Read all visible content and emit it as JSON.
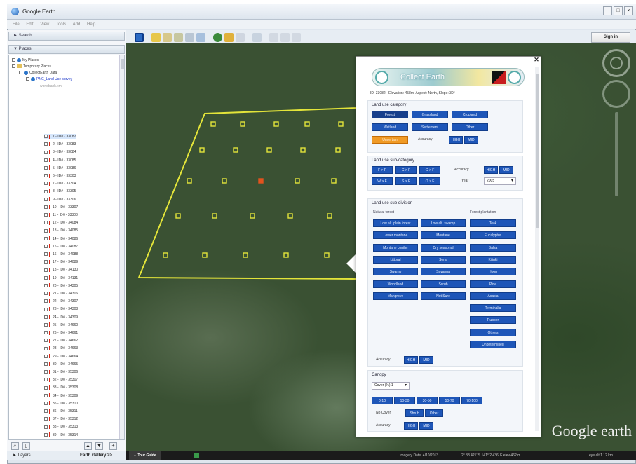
{
  "app": {
    "title": "Google Earth"
  },
  "window_controls": [
    "–",
    "□",
    "×"
  ],
  "menu": [
    "File",
    "Edit",
    "View",
    "Tools",
    "Add",
    "Help"
  ],
  "toolbar": {
    "signin_label": "Sign in"
  },
  "sidebar": {
    "search_label": "► Search",
    "places_label": "▼ Places",
    "tree": [
      {
        "label": "My Places",
        "type": "globe",
        "indent": 1
      },
      {
        "label": "Temporary Places",
        "type": "folder",
        "indent": 1
      },
      {
        "label": "CollectEarth Data",
        "type": "globe",
        "indent": 2
      },
      {
        "label": "PNG_Land Use survey",
        "type": "link",
        "indent": 3
      },
      {
        "label": "worldbank.xml",
        "type": "dim",
        "indent": 4
      }
    ],
    "items": [
      "1 - ID# - 33082",
      "2 - ID# - 33083",
      "3 - ID# - 33084",
      "4 - ID# - 33085",
      "5 - ID# - 33086",
      "6 - ID# - 33303",
      "7 - ID# - 33304",
      "8 - ID# - 33305",
      "9 - ID# - 33306",
      "10 - ID# - 33307",
      "11 - ID# - 33308",
      "12 - ID# - 34084",
      "13 - ID# - 34085",
      "14 - ID# - 34086",
      "15 - ID# - 34087",
      "16 - ID# - 34088",
      "17 - ID# - 34089",
      "18 - ID# - 34130",
      "19 - ID# - 34131",
      "20 - ID# - 34305",
      "21 - ID# - 34306",
      "22 - ID# - 34307",
      "23 - ID# - 34308",
      "24 - ID# - 34309",
      "25 - ID# - 34660",
      "26 - ID# - 34661",
      "27 - ID# - 34662",
      "28 - ID# - 34663",
      "29 - ID# - 34664",
      "30 - ID# - 34665",
      "31 - ID# - 35306",
      "32 - ID# - 35307",
      "33 - ID# - 35308",
      "34 - ID# - 35309",
      "35 - ID# - 35310",
      "36 - ID# - 35311",
      "37 - ID# - 35312",
      "38 - ID# - 35313",
      "39 - ID# - 35314"
    ],
    "layers_label": "► Layers",
    "earth_gallery_label": "Earth Gallery >>"
  },
  "statusbar": {
    "tour_guide": "▲ Tour Guide",
    "imagery_date": "Imagery Date: 4/10/2013",
    "coords": "2° 38.421' S  141° 2.436' E  elev  462 m",
    "eye_alt": "eye alt  1.12 km"
  },
  "balloon": {
    "banner_title": "Collect Earth",
    "subtitle": "ID: 33082 - Elevation: 458m, Aspect: North, Slope: 30°",
    "land_use_category": {
      "title": "Land use category",
      "buttons": [
        "Forest",
        "Grassland",
        "Cropland",
        "Wetland",
        "Settlement",
        "Other"
      ],
      "selected": "Forest",
      "other_selected": "Uncertain",
      "accuracy_label": "Accuracy",
      "accuracy_options": [
        "HIGH",
        "MID"
      ]
    },
    "land_use_subcategory": {
      "title": "Land use sub-category",
      "buttons": [
        "F > F",
        "C > F",
        "G > F",
        "W > F",
        "S > F",
        "O > F"
      ],
      "accuracy_label": "Accuracy",
      "accuracy_options": [
        "HIGH",
        "MID"
      ],
      "year_label": "Year",
      "year_value": "2005"
    },
    "land_use_subdivision": {
      "title": "Land use sub-division",
      "natural_title": "Natural forest",
      "natural": [
        "Low alt. plain forest",
        "Lower montane",
        "Montane conifer",
        "Littoral",
        "Swamp",
        "Woodland",
        "Mangrove"
      ],
      "natural2": [
        "Low alt. swamp",
        "Montane",
        "Dry seasonal",
        "Seral",
        "Savanna",
        "Scrub",
        "Not Sure"
      ],
      "plantation_title": "Forest plantation",
      "plantation": [
        "Teak",
        "Eucalyptus",
        "Balsa",
        "Kilinki",
        "Hoop",
        "Pine",
        "Acacia",
        "Terminalia",
        "Rubber",
        "Others",
        "Undetermined"
      ],
      "accuracy_label": "Accuracy",
      "accuracy_options": [
        "HIGH",
        "MID"
      ]
    },
    "canopy": {
      "title": "Canopy",
      "select_value": "Cover (%) 1",
      "ranges": [
        "0-10",
        "10-30",
        "30-50",
        "50-70",
        "70-100"
      ],
      "no_cover_label": "No Cover",
      "shrub_label": "Shrub",
      "other_label": "Other",
      "accuracy_label": "Accuracy",
      "accuracy_options": [
        "HIGH",
        "MID"
      ]
    }
  },
  "map": {
    "logo": "Google earth"
  },
  "colors": {
    "button_blue": "#1e56b8",
    "button_orange": "#f09a25",
    "plot_outline": "#e3e43a",
    "sample_point": "#e3e43a",
    "highlight_point": "#e2531e"
  }
}
